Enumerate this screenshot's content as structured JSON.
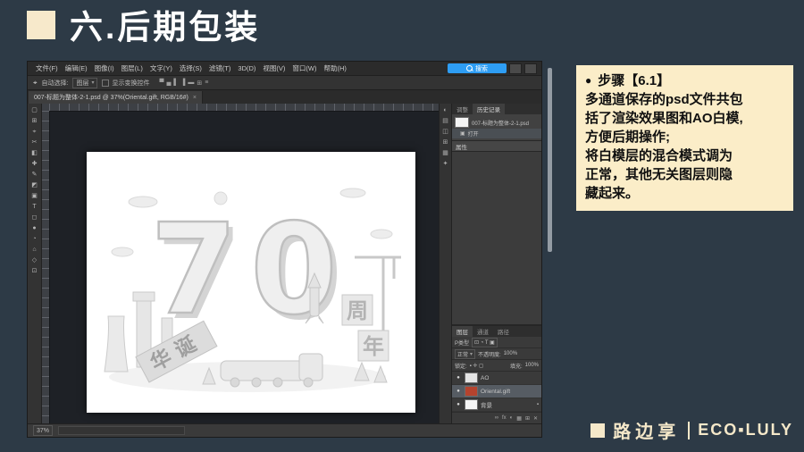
{
  "slide": {
    "title": "六.后期包装",
    "note": {
      "bullet": "●",
      "heading": "步骤【6.1】",
      "lines": [
        "多通道保存的psd文件共包",
        "括了渲染效果图和AO白模,",
        "方便后期操作;",
        "将白模层的混合模式调为",
        "正常，其他无关图层则隐",
        "藏起来。"
      ]
    },
    "footer": {
      "brand": "路边享",
      "logo": "ECO▪LULY"
    }
  },
  "photoshop": {
    "menu": [
      "文件(F)",
      "编辑(E)",
      "图像(I)",
      "图层(L)",
      "文字(Y)",
      "选择(S)",
      "滤镜(T)",
      "3D(D)",
      "视图(V)",
      "窗口(W)",
      "帮助(H)"
    ],
    "search_label": "搜索",
    "options": {
      "label": "自动选择:",
      "value": "图层",
      "checkbox": "显示变换控件",
      "icons": [
        "▀",
        "▄",
        "▌",
        "▐",
        "▬",
        "⊞",
        "≡"
      ]
    },
    "doc_tab": {
      "title": "007-标题为整体-2-1.psd @ 37%(Oriental.gift, RGB/16#)",
      "close": "×"
    },
    "tools": [
      "▢",
      "⊞",
      "⌖",
      "✂",
      "◧",
      "✚",
      "✎",
      "◩",
      "▣",
      "T",
      "◻",
      "●",
      "◔",
      "⌂",
      "◇",
      "⊡"
    ],
    "panel_icons": [
      "◐",
      "▤",
      "◫",
      "⊞",
      "▦",
      "✦"
    ],
    "history": {
      "tabs": [
        "调整",
        "历史记录"
      ],
      "snapshot": "007-标题为整体-2-1.psd",
      "entries": [
        "打开"
      ]
    },
    "properties": {
      "title": "属性"
    },
    "layers": {
      "tabs": [
        "图层",
        "通道",
        "路径"
      ],
      "filter": "P类型",
      "blend": "正常",
      "opacity_label": "不透明度:",
      "opacity": "100%",
      "lock_label": "锁定:",
      "fill_label": "填充:",
      "fill": "100%",
      "rows": [
        {
          "name": "AO",
          "thumb": "#e4e4e4"
        },
        {
          "name": "Oriental.gift",
          "thumb": "#b5432e",
          "selected": true
        },
        {
          "name": "背景",
          "thumb": "#f5f5f5",
          "locked": true
        }
      ],
      "footer_icons": [
        "∞",
        "fx",
        "◐",
        "▦",
        "⊞",
        "✕"
      ]
    },
    "status": {
      "zoom": "37%"
    },
    "icons": {
      "chevron": "▾",
      "eye": "●",
      "lock": "▪",
      "state": "▣"
    },
    "artwork": {
      "big_left": "7",
      "big_right": "0",
      "year_top": "周",
      "year_bottom": "年",
      "banner": "华诞"
    }
  }
}
